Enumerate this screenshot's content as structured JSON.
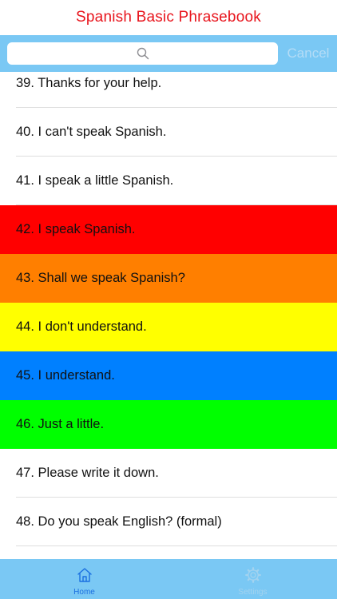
{
  "app": {
    "title": "Spanish Basic Phrasebook",
    "title_color": "#e8141c"
  },
  "search": {
    "placeholder": "",
    "value": "",
    "icon": "search-icon",
    "cancel_label": "Cancel"
  },
  "colors": {
    "bar_blue": "#7ac8f4",
    "row_red": "#ff0000",
    "row_orange": "#ff7f00",
    "row_yellow": "#ffff00",
    "row_blue": "#0080ff",
    "row_green": "#00ff00",
    "tab_active": "#1a6fe0",
    "tab_inactive": "#a3d3ef"
  },
  "phrases": [
    {
      "text": "39. Thanks for your help.",
      "background": "#ffffff"
    },
    {
      "text": "40. I can't speak Spanish.",
      "background": "#ffffff"
    },
    {
      "text": "41. I speak a little Spanish.",
      "background": "#ffffff"
    },
    {
      "text": "42. I speak Spanish.",
      "background": "#ff0000"
    },
    {
      "text": "43. Shall we speak Spanish?",
      "background": "#ff7f00"
    },
    {
      "text": "44. I don't understand.",
      "background": "#ffff00"
    },
    {
      "text": "45. I understand.",
      "background": "#0080ff"
    },
    {
      "text": "46. Just a little.",
      "background": "#00ff00"
    },
    {
      "text": "47. Please write it down.",
      "background": "#ffffff"
    },
    {
      "text": "48. Do you speak English? (formal)",
      "background": "#ffffff"
    }
  ],
  "tabs": {
    "home": {
      "label": "Home",
      "icon": "home-icon",
      "active": true
    },
    "settings": {
      "label": "Settings",
      "icon": "gear-icon",
      "active": false
    }
  }
}
